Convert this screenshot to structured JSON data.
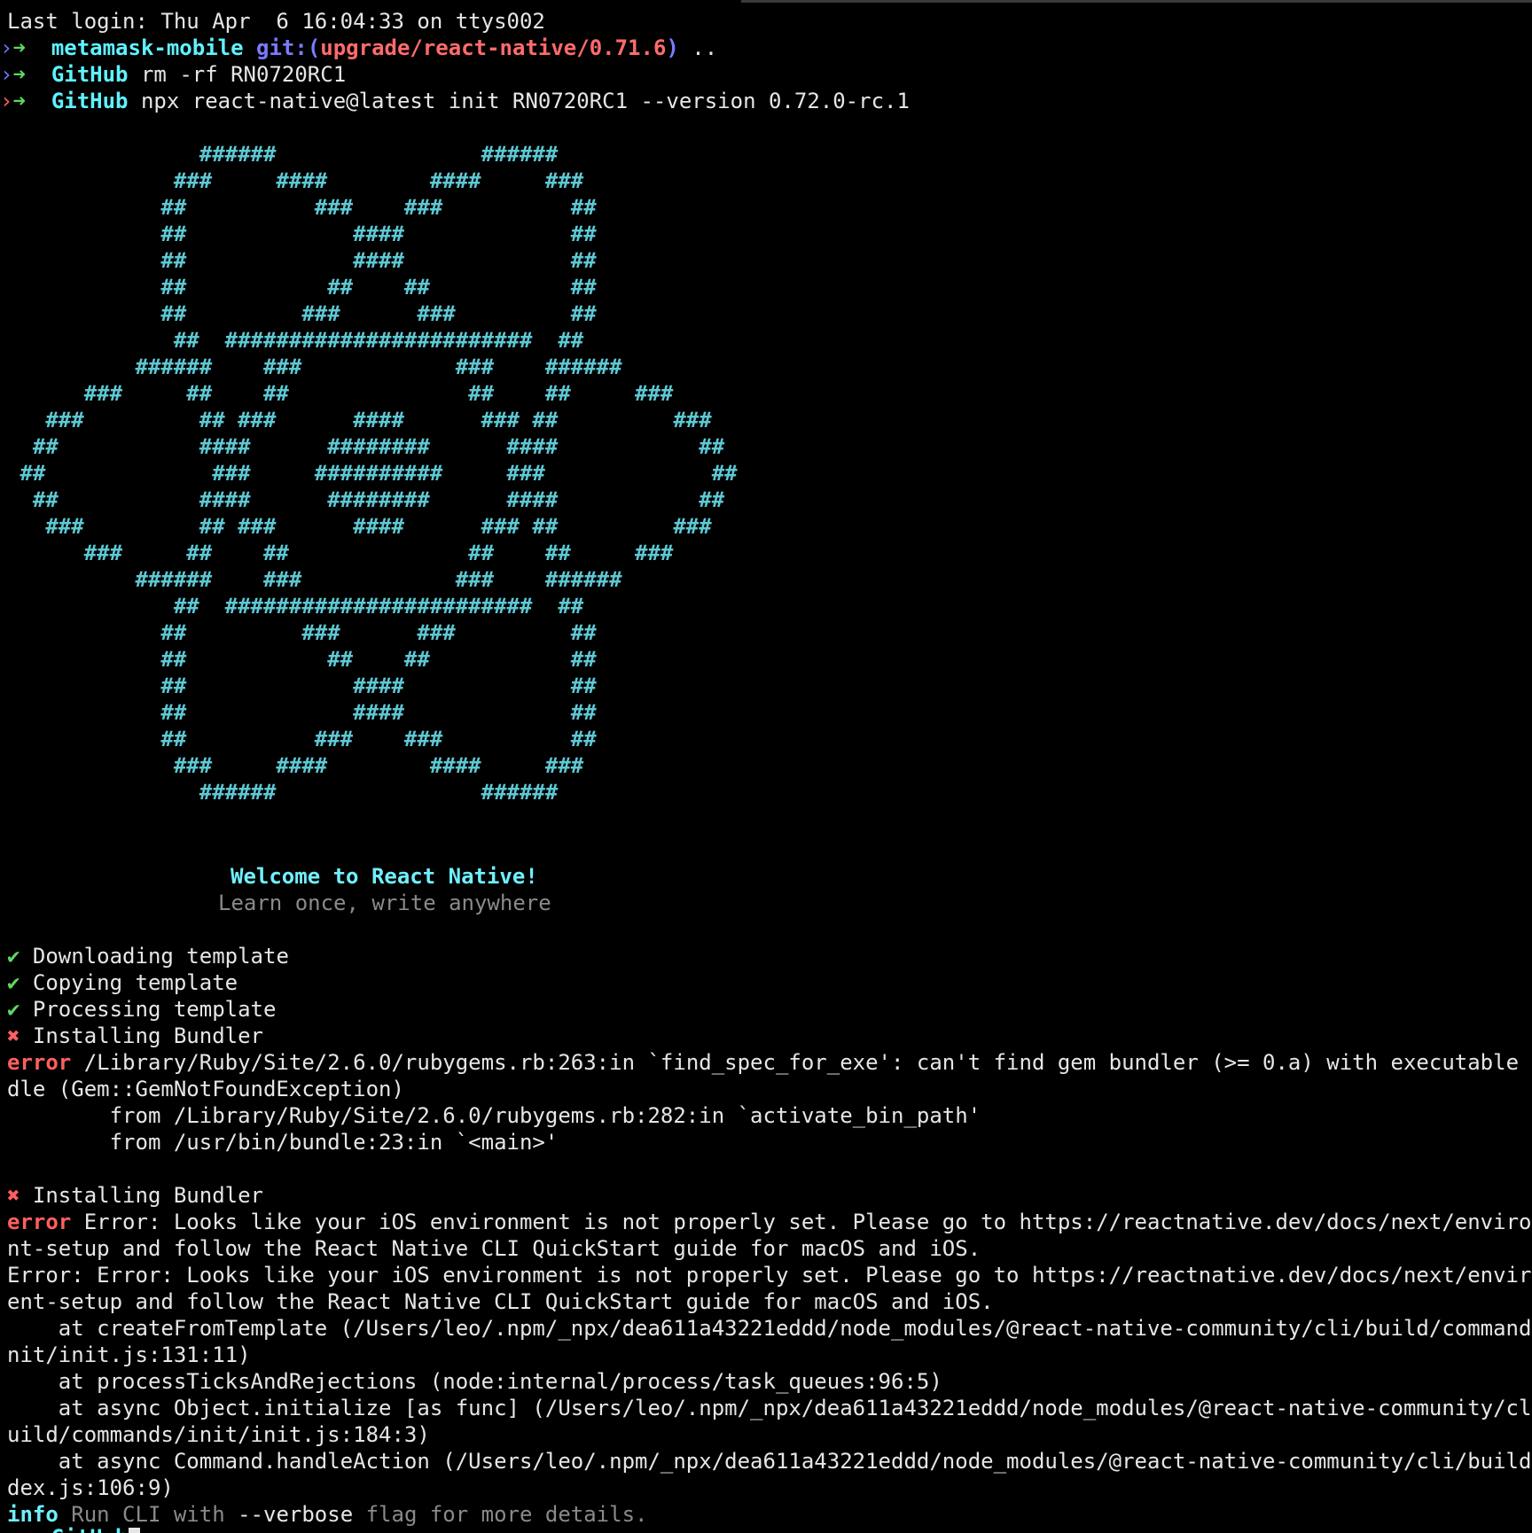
{
  "colors": {
    "background": "#000000",
    "text": "#e6e6e6",
    "prompt_arrow_ok": "#5fd75f",
    "prompt_arrow_fail": "#ff5f5f",
    "prompt_caret": "#6e72ff",
    "dir_name": "#5ff2ff",
    "git_label": "#7b7bff",
    "git_branch": "#ff6b6b",
    "logo": "#5ec8d4",
    "welcome": "#6ff0ff",
    "tagline": "#8a8a8a",
    "check": "#5fd75f",
    "cross": "#ff5f5f",
    "error": "#ff5f5f",
    "info": "#6ff0ff",
    "dim": "#8a8a8a"
  },
  "terminal": {
    "last_login": "Last login: Thu Apr  6 16:04:33 on ttys002",
    "prompt1": {
      "arrow": "➜",
      "dir": "metamask-mobile",
      "git_label": "git:(",
      "branch": "upgrade/react-native/0.71.6",
      "git_close": ")",
      "cmd": " .."
    },
    "prompt2": {
      "arrow": "➜",
      "dir": "GitHub",
      "cmd": " rm -rf RN0720RC1"
    },
    "prompt3": {
      "arrow": "➜",
      "dir": "GitHub",
      "cmd": " npx react-native@latest init RN0720RC1 --version 0.72.0-rc.1"
    },
    "logo_lines": [
      "               ######                ######",
      "             ###     ####        ####     ###",
      "            ##          ###    ###          ##",
      "            ##             ####             ##",
      "            ##             ####             ##",
      "            ##           ##    ##           ##",
      "            ##         ###      ###         ##",
      "             ##  ########################  ##",
      "          ######    ###            ###    ######",
      "      ###     ##    ##              ##    ##     ###",
      "   ###         ## ###      ####      ### ##         ###",
      "  ##           ####      ########      ####           ##",
      " ##             ###     ##########     ###             ##",
      "  ##           ####      ########      ####           ##",
      "   ###         ## ###      ####      ### ##         ###",
      "      ###     ##    ##              ##    ##     ###",
      "          ######    ###            ###    ######",
      "             ##  ########################  ##",
      "            ##         ###      ###         ##",
      "            ##           ##    ##           ##",
      "            ##             ####             ##",
      "            ##             ####             ##",
      "            ##          ###    ###          ##",
      "             ###     ####        ####     ###",
      "               ######                ######"
    ],
    "welcome": "Welcome to React Native!",
    "tagline": "Learn once, write anywhere",
    "steps": [
      {
        "mark": "✔",
        "text": " Downloading template"
      },
      {
        "mark": "✔",
        "text": " Copying template"
      },
      {
        "mark": "✔",
        "text": " Processing template"
      },
      {
        "mark": "✖",
        "text": " Installing Bundler"
      }
    ],
    "error1": {
      "label": "error",
      "line1": " /Library/Ruby/Site/2.6.0/rubygems.rb:263:in `find_spec_for_exe': can't find gem bundler (>= 0.a) with executable bun",
      "line2": "dle (Gem::GemNotFoundException)",
      "line3": "        from /Library/Ruby/Site/2.6.0/rubygems.rb:282:in `activate_bin_path'",
      "line4": "        from /usr/bin/bundle:23:in `<main>'"
    },
    "step5": {
      "mark": "✖",
      "text": " Installing Bundler"
    },
    "error2": {
      "label": "error",
      "line1": " Error: Looks like your iOS environment is not properly set. Please go to https://reactnative.dev/docs/next/environme",
      "line2": "nt-setup and follow the React Native CLI QuickStart guide for macOS and iOS.",
      "line3": "Error: Error: Looks like your iOS environment is not properly set. Please go to https://reactnative.dev/docs/next/environm",
      "line4": "ent-setup and follow the React Native CLI QuickStart guide for macOS and iOS.",
      "line5": "    at createFromTemplate (/Users/leo/.npm/_npx/dea611a43221eddd/node_modules/@react-native-community/cli/build/commands/i",
      "line6": "nit/init.js:131:11)",
      "line7": "    at processTicksAndRejections (node:internal/process/task_queues:96:5)",
      "line8": "    at async Object.initialize [as func] (/Users/leo/.npm/_npx/dea611a43221eddd/node_modules/@react-native-community/cli/b",
      "line9": "uild/commands/init/init.js:184:3)",
      "line10": "    at async Command.handleAction (/Users/leo/.npm/_npx/dea611a43221eddd/node_modules/@react-native-community/cli/build/in",
      "line11": "dex.js:106:9)"
    },
    "info": {
      "label": "info",
      "pre": " Run CLI with ",
      "flag": "--verbose",
      "post": " flag for more details."
    },
    "last_prompt": {
      "arrow": "➜",
      "dir": "GitHub"
    }
  }
}
